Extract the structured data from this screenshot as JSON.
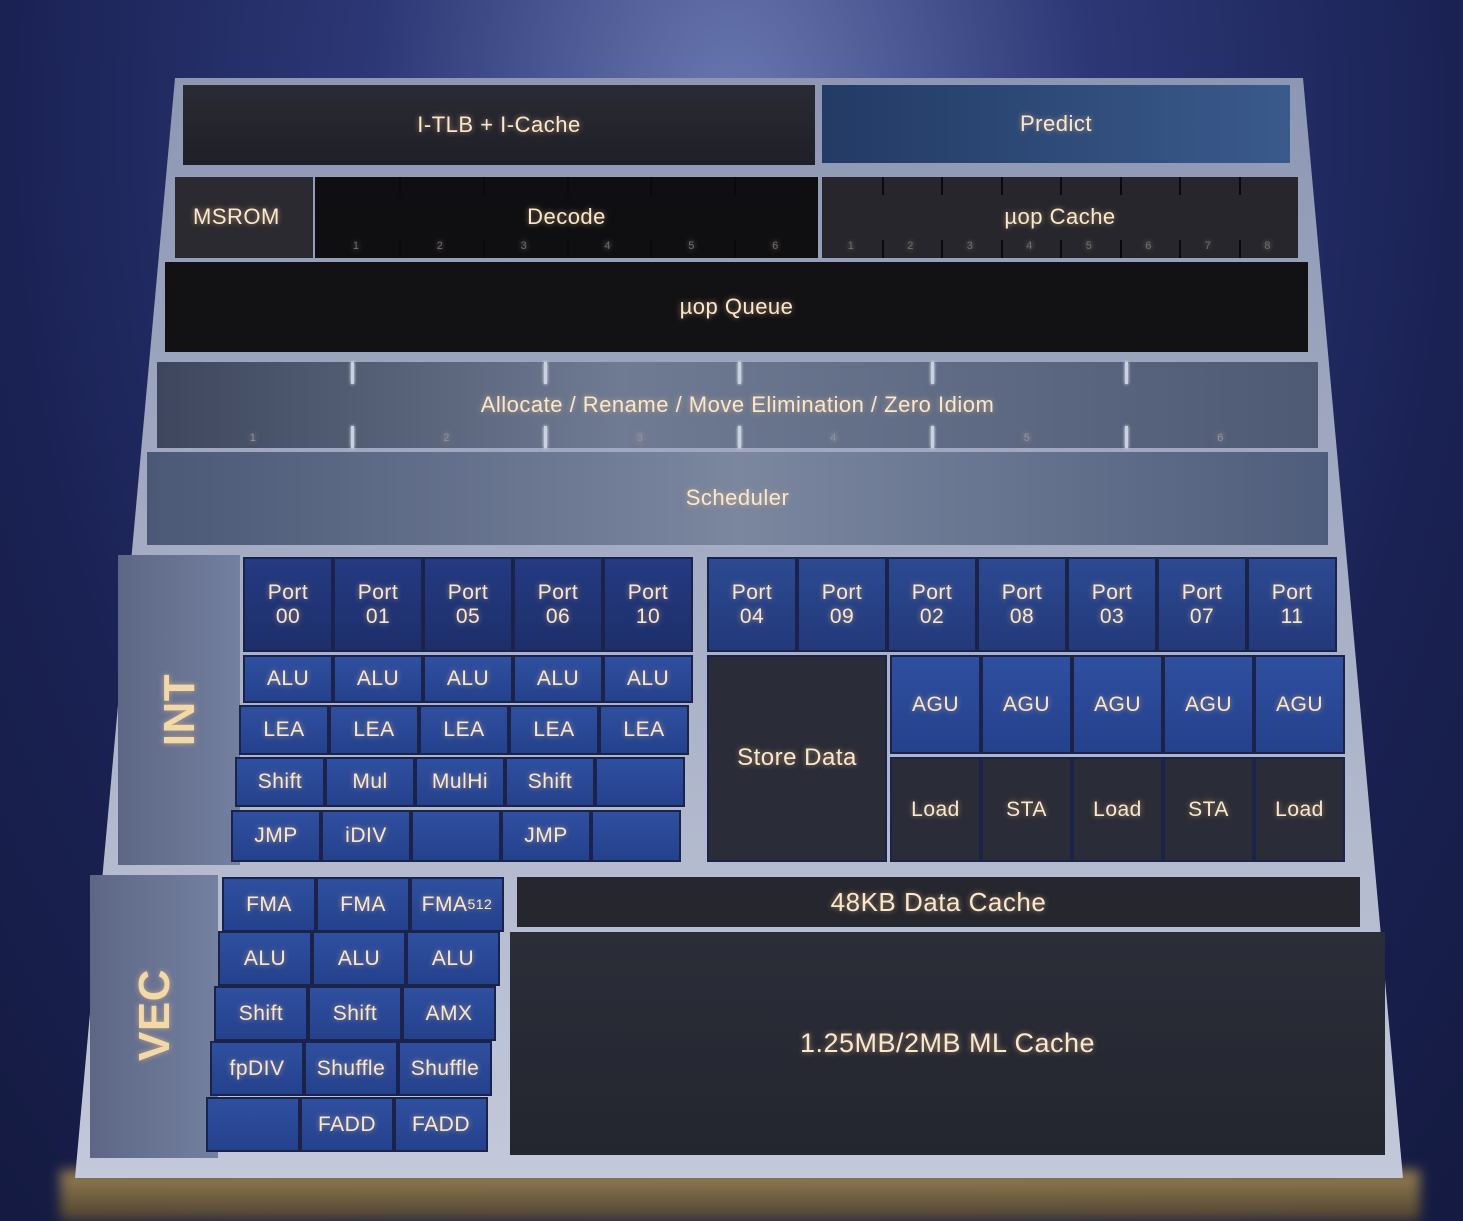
{
  "frontend": {
    "itlb": "I-TLB + I-Cache",
    "predict": "Predict",
    "msrom": "MSROM",
    "decode": "Decode",
    "decode_slots": [
      "1",
      "2",
      "3",
      "4",
      "5",
      "6"
    ],
    "uop_cache": "µop Cache",
    "uop_cache_slots": [
      "1",
      "2",
      "3",
      "4",
      "5",
      "6",
      "7",
      "8"
    ],
    "uop_queue": "µop Queue",
    "allocate": "Allocate / Rename / Move Elimination / Zero Idiom",
    "allocate_slots": [
      "1",
      "2",
      "3",
      "4",
      "5",
      "6"
    ],
    "scheduler": "Scheduler"
  },
  "int": {
    "label": "INT",
    "ports": [
      {
        "name": "Port",
        "num": "00"
      },
      {
        "name": "Port",
        "num": "01"
      },
      {
        "name": "Port",
        "num": "05"
      },
      {
        "name": "Port",
        "num": "06"
      },
      {
        "name": "Port",
        "num": "10"
      },
      {
        "name": "Port",
        "num": "04"
      },
      {
        "name": "Port",
        "num": "09"
      },
      {
        "name": "Port",
        "num": "02"
      },
      {
        "name": "Port",
        "num": "08"
      },
      {
        "name": "Port",
        "num": "03"
      },
      {
        "name": "Port",
        "num": "07"
      },
      {
        "name": "Port",
        "num": "11"
      }
    ],
    "alu_rows": [
      [
        "ALU",
        "ALU",
        "ALU",
        "ALU",
        "ALU"
      ],
      [
        "LEA",
        "LEA",
        "LEA",
        "LEA",
        "LEA"
      ],
      [
        "Shift",
        "Mul",
        "MulHi",
        "Shift",
        ""
      ],
      [
        "JMP",
        "iDIV",
        "",
        "JMP",
        ""
      ]
    ],
    "store_data": "Store Data",
    "agu": [
      "AGU",
      "AGU",
      "AGU",
      "AGU",
      "AGU"
    ],
    "load_sta": [
      "Load",
      "STA",
      "Load",
      "STA",
      "Load"
    ]
  },
  "vec": {
    "label": "VEC",
    "rows": [
      [
        "FMA",
        "FMA",
        "FMA512"
      ],
      [
        "ALU",
        "ALU",
        "ALU"
      ],
      [
        "Shift",
        "Shift",
        "AMX"
      ],
      [
        "fpDIV",
        "Shuffle",
        "Shuffle"
      ],
      [
        "",
        "FADD",
        "FADD"
      ]
    ],
    "data_cache": "48KB Data Cache",
    "ml_cache": "1.25MB/2MB ML Cache"
  },
  "colors": {
    "text": "#f7e8cf",
    "predict": "#2c4a78",
    "unit_blue": "#2f4fa0",
    "port_blue": "#1d2f6a"
  }
}
